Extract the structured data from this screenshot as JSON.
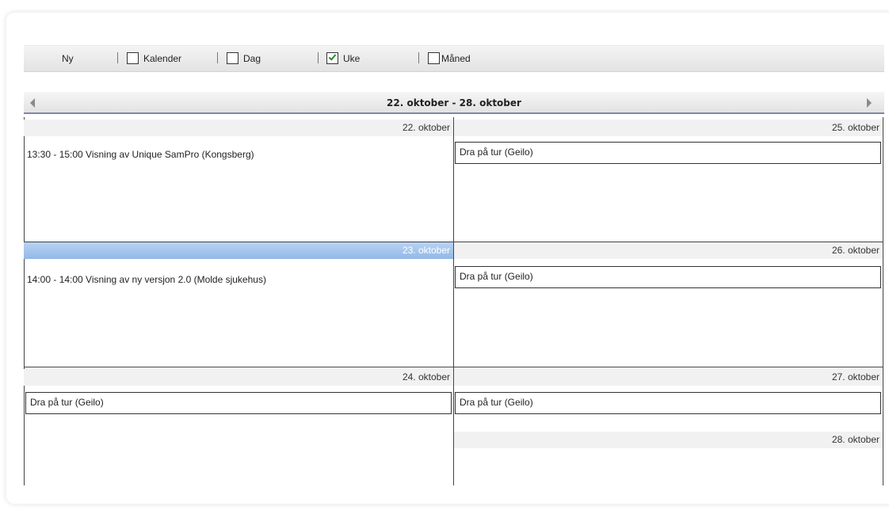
{
  "toolbar": {
    "new_label": "Ny",
    "views": [
      {
        "label": "Kalender",
        "checked": false
      },
      {
        "label": "Dag",
        "checked": false
      },
      {
        "label": "Uke",
        "checked": true
      },
      {
        "label": "Måned",
        "checked": false
      }
    ]
  },
  "week": {
    "title": "22. oktober - 28. oktober",
    "prev_icon": "arrow-left-icon",
    "next_icon": "arrow-right-icon"
  },
  "days": {
    "d22": {
      "date": "22. oktober",
      "events": [
        "13:30 - 15:00 Visning av Unique SamPro (Kongsberg)"
      ]
    },
    "d23": {
      "date": "23. oktober",
      "selected": true,
      "events": [
        "14:00 - 14:00 Visning av ny versjon 2.0 (Molde sjukehus)"
      ]
    },
    "d24": {
      "date": "24. oktober",
      "events": [
        "Dra på tur (Geilo)"
      ]
    },
    "d25": {
      "date": "25. oktober",
      "events": [
        "Dra på tur (Geilo)"
      ]
    },
    "d26": {
      "date": "26. oktober",
      "events": [
        "Dra på tur (Geilo)"
      ]
    },
    "d27": {
      "date": "27. oktober",
      "events": [
        "Dra på tur (Geilo)"
      ]
    },
    "d28": {
      "date": "28. oktober",
      "events": []
    }
  },
  "colors": {
    "selected_day": "#92b8e6",
    "check_mark": "#2a8a2a",
    "header_border": "#7d88a6"
  }
}
